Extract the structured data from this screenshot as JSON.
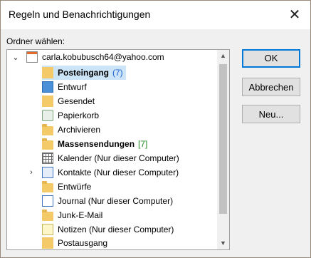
{
  "window": {
    "title": "Regeln und Benachrichtigungen",
    "close_glyph": "✕"
  },
  "folder_label": "Ordner wählen:",
  "tree": {
    "account": "carla.kobubusch64@yahoo.com",
    "expanded_glyph": "⌄",
    "collapsed_glyph": "›",
    "items": [
      {
        "label": "Posteingang",
        "count": "(7)",
        "bold": true,
        "icon": "inbox-icon"
      },
      {
        "label": "Entwurf",
        "icon": "drafts-icon"
      },
      {
        "label": "Gesendet",
        "icon": "sent-icon"
      },
      {
        "label": "Papierkorb",
        "icon": "recycle-bin-icon"
      },
      {
        "label": "Archivieren",
        "icon": "folder-icon"
      },
      {
        "label": "Massensendungen",
        "count": "[7]",
        "bold": true,
        "icon": "spam-folder-icon"
      },
      {
        "label": "Kalender (Nur dieser Computer)",
        "icon": "calendar-icon"
      },
      {
        "label": "Kontakte (Nur dieser Computer)",
        "icon": "contacts-icon"
      },
      {
        "label": "Entwürfe",
        "icon": "folder-icon"
      },
      {
        "label": "Journal (Nur dieser Computer)",
        "icon": "journal-icon"
      },
      {
        "label": "Junk-E-Mail",
        "icon": "folder-icon"
      },
      {
        "label": "Notizen (Nur dieser Computer)",
        "icon": "notes-icon"
      },
      {
        "label": "Postausgang",
        "icon": "outbox-icon"
      }
    ],
    "scroll_up_glyph": "▲",
    "scroll_down_glyph": "▼"
  },
  "buttons": {
    "ok": "OK",
    "unsubscribe": "Abbrechen",
    "new": "Neu..."
  }
}
